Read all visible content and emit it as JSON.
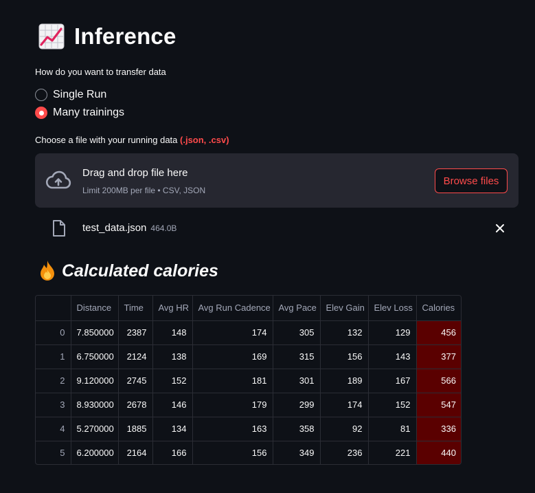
{
  "header": {
    "title": "Inference",
    "icon": "chart-increasing-icon"
  },
  "transfer": {
    "label": "How do you want to transfer data",
    "options": [
      "Single Run",
      "Many trainings"
    ],
    "selected": "Many trainings"
  },
  "uploader": {
    "label": "Choose a file with your running data ",
    "label_accent": "(.json, .csv)",
    "drop_title": "Drag and drop file here",
    "drop_subtitle": "Limit 200MB per file • CSV, JSON",
    "browse_label": "Browse files"
  },
  "file": {
    "name": "test_data.json",
    "size": "464.0B"
  },
  "section": {
    "title": "Calculated calories",
    "icon": "fire-icon"
  },
  "table": {
    "columns": [
      "",
      "Distance",
      "Time",
      "Avg HR",
      "Avg Run Cadence",
      "Avg Pace",
      "Elev Gain",
      "Elev Loss",
      "Calories"
    ],
    "rows": [
      [
        "0",
        "7.850000",
        "2387",
        "148",
        "174",
        "305",
        "132",
        "129",
        "456"
      ],
      [
        "1",
        "6.750000",
        "2124",
        "138",
        "169",
        "315",
        "156",
        "143",
        "377"
      ],
      [
        "2",
        "9.120000",
        "2745",
        "152",
        "181",
        "301",
        "189",
        "167",
        "566"
      ],
      [
        "3",
        "8.930000",
        "2678",
        "146",
        "179",
        "299",
        "174",
        "152",
        "547"
      ],
      [
        "4",
        "5.270000",
        "1885",
        "134",
        "163",
        "358",
        "92",
        "81",
        "336"
      ],
      [
        "5",
        "6.200000",
        "2164",
        "166",
        "156",
        "349",
        "236",
        "221",
        "440"
      ]
    ],
    "highlight_color": "#5a0000"
  },
  "colors": {
    "background": "#0e1117",
    "accent": "#ff4b4b",
    "panel": "#262730"
  }
}
